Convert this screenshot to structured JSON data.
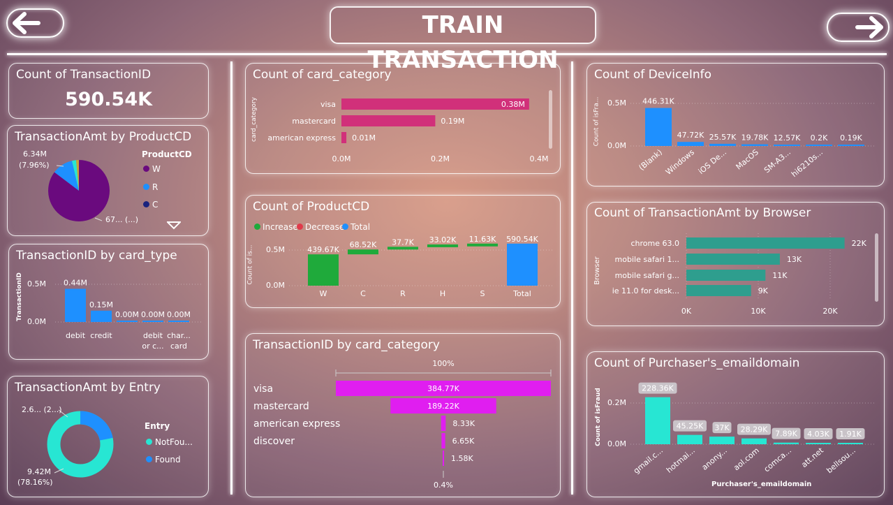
{
  "header": {
    "title": "TRAIN TRANSACTION"
  },
  "nav": {
    "back_icon": "arrow-left-icon",
    "forward_icon": "arrow-right-icon"
  },
  "kpi": {
    "title": "Count of TransactionID",
    "value": "590.54K"
  },
  "product_pie": {
    "title": "TransactionAmt by ProductCD",
    "label_small": "6.34M",
    "label_small_pct": "(7.96%)",
    "label_large": "67... (...)",
    "legend_title": "ProductCD",
    "legend": [
      {
        "name": "W",
        "color": "#6a0a7e"
      },
      {
        "name": "R",
        "color": "#1e90ff"
      },
      {
        "name": "C",
        "color": "#1a237e"
      }
    ],
    "scroll_icon": "triangle-down-icon"
  },
  "card_type": {
    "title": "TransactionID by card_type",
    "ylabel": "TransactionID",
    "yticks": [
      "0.5M",
      "0.0M"
    ],
    "bars": [
      {
        "cat1": "debit",
        "cat2": "",
        "label": "0.44M",
        "value": 0.44
      },
      {
        "cat1": "credit",
        "cat2": "",
        "label": "0.15M",
        "value": 0.15
      },
      {
        "cat1": "",
        "cat2": "",
        "label": "0.00M",
        "value": 0.0
      },
      {
        "cat1": "debit",
        "cat2": "or c...",
        "label": "0.00M",
        "value": 0.0
      },
      {
        "cat1": "char...",
        "cat2": "card",
        "label": "0.00M",
        "value": 0.0
      }
    ]
  },
  "entry": {
    "title": "TransactionAmt by Entry",
    "label_small": "2.6... (2...)",
    "label_large": "9.42M",
    "label_large_pct": "(78.16%)",
    "legend_title": "Entry",
    "legend": [
      {
        "name": "NotFou...",
        "color": "#27e6d3"
      },
      {
        "name": "Found",
        "color": "#1e90ff"
      }
    ]
  },
  "card_category": {
    "title": "Count of card_category",
    "ylabel": "card_category",
    "xticks": [
      "0.0M",
      "0.2M",
      "0.4M"
    ],
    "bars": [
      {
        "name": "visa",
        "label": "0.38M",
        "value": 0.38
      },
      {
        "name": "mastercard",
        "label": "0.19M",
        "value": 0.19
      },
      {
        "name": "american express",
        "label": "0.01M",
        "value": 0.01
      }
    ]
  },
  "product_waterfall": {
    "title": "Count of ProductCD",
    "legend": [
      {
        "name": "Increase",
        "color": "#1faa3b"
      },
      {
        "name": "Decrease",
        "color": "#e0394a"
      },
      {
        "name": "Total",
        "color": "#1e90ff"
      }
    ],
    "ylabel": "Count of is...",
    "yticks": [
      "0.5M",
      "0.0M"
    ],
    "steps": [
      {
        "cat": "W",
        "label": "439.67K",
        "value": 439.67
      },
      {
        "cat": "C",
        "label": "68.52K",
        "value": 68.52
      },
      {
        "cat": "R",
        "label": "37.7K",
        "value": 37.7
      },
      {
        "cat": "H",
        "label": "33.02K",
        "value": 33.02
      },
      {
        "cat": "S",
        "label": "11.63K",
        "value": 11.63
      },
      {
        "cat": "Total",
        "label": "590.54K",
        "value": 590.54
      }
    ]
  },
  "funnel": {
    "title": "TransactionID by card_category",
    "top_pct": "100%",
    "bottom_pct": "0.4%",
    "rows": [
      {
        "name": "visa",
        "label": "384.77K",
        "value": 384.77
      },
      {
        "name": "mastercard",
        "label": "189.22K",
        "value": 189.22
      },
      {
        "name": "american express",
        "label": "8.33K",
        "value": 8.33
      },
      {
        "name": "discover",
        "label": "6.65K",
        "value": 6.65
      },
      {
        "name": "",
        "label": "1.58K",
        "value": 1.58
      }
    ]
  },
  "device": {
    "title": "Count of DeviceInfo",
    "ylabel": "Count of isFra...",
    "yticks": [
      "0.5M",
      "0.0M"
    ],
    "bars": [
      {
        "cat": "(Blank)",
        "label": "446.31K",
        "value": 446.31
      },
      {
        "cat": "Windows",
        "label": "47.72K",
        "value": 47.72
      },
      {
        "cat": "iOS De...",
        "label": "25.57K",
        "value": 25.57
      },
      {
        "cat": "MacOS",
        "label": "19.78K",
        "value": 19.78
      },
      {
        "cat": "SM-A3...",
        "label": "12.57K",
        "value": 12.57
      },
      {
        "cat": "hi6210s...",
        "label": "0.2K",
        "value": 0.2
      },
      {
        "cat": "",
        "label": "0.19K",
        "value": 0.19
      }
    ]
  },
  "browser": {
    "title": "Count of TransactionAmt by Browser",
    "ylabel": "Browser",
    "xticks": [
      "0K",
      "10K",
      "20K"
    ],
    "bars": [
      {
        "name": "chrome 63.0",
        "label": "22K",
        "value": 22
      },
      {
        "name": "mobile safari 1...",
        "label": "13K",
        "value": 13
      },
      {
        "name": "mobile safari g...",
        "label": "11K",
        "value": 11
      },
      {
        "name": "ie 11.0 for desk...",
        "label": "9K",
        "value": 9
      }
    ]
  },
  "email": {
    "title": "Count of Purchaser's_emaildomain",
    "ylabel": "Count of isFraud",
    "xlabel": "Purchaser's_emaildomain",
    "yticks": [
      "0.2M",
      "0.0M"
    ],
    "bars": [
      {
        "cat": "gmail.c...",
        "label": "228.36K",
        "value": 228.36
      },
      {
        "cat": "hotmai...",
        "label": "45.25K",
        "value": 45.25
      },
      {
        "cat": "anony...",
        "label": "37K",
        "value": 37
      },
      {
        "cat": "aol.com",
        "label": "28.29K",
        "value": 28.29
      },
      {
        "cat": "comca...",
        "label": "7.89K",
        "value": 7.89
      },
      {
        "cat": "att.net",
        "label": "4.03K",
        "value": 4.03
      },
      {
        "cat": "bellsou...",
        "label": "1.91K",
        "value": 1.91
      }
    ]
  }
}
